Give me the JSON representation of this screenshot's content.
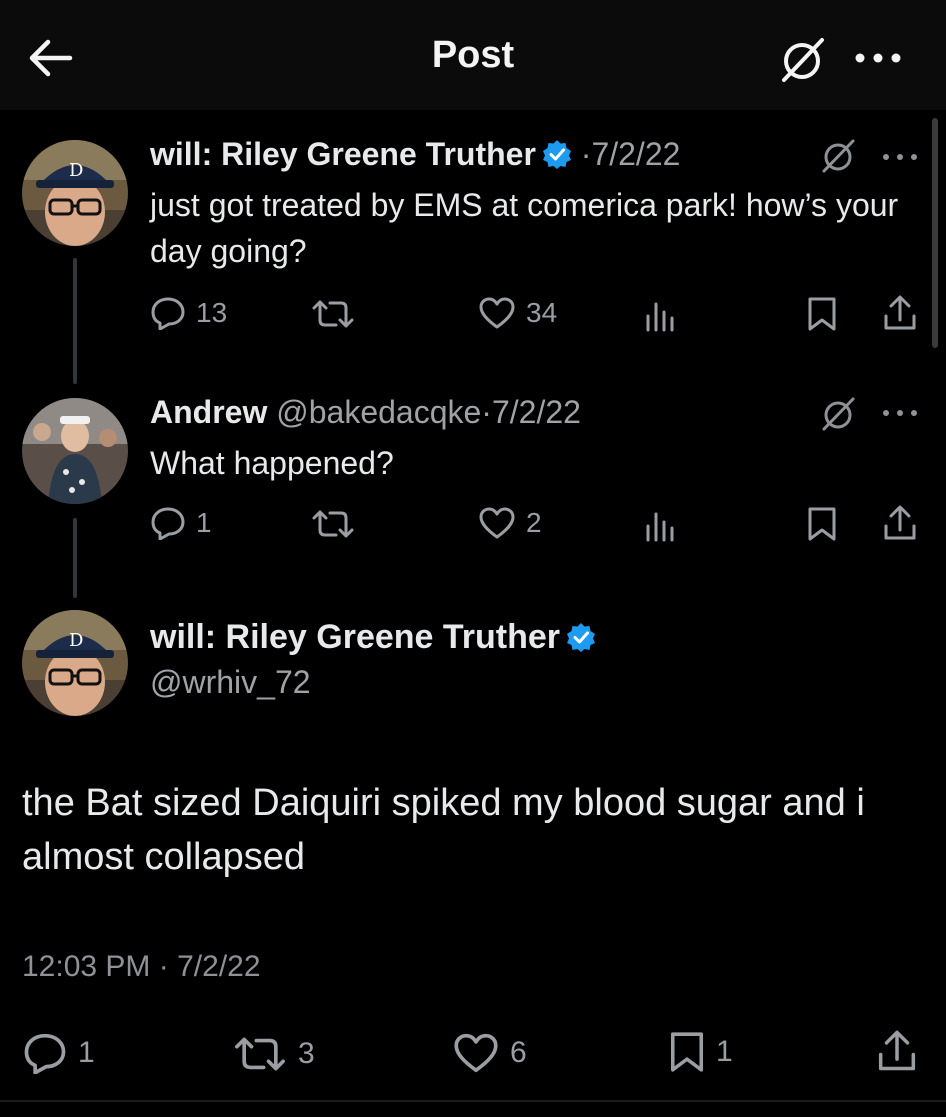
{
  "header": {
    "title": "Post",
    "back_icon": "arrow-left-icon",
    "grok_icon": "grok-icon",
    "more_icon": "more-horizontal-icon"
  },
  "colors": {
    "background": "#000000",
    "header_background": "#0b0b0b",
    "text": "#e7e9ea",
    "muted": "#a0a3a6",
    "verified": "#1d9bf0"
  },
  "tweets": [
    {
      "name": "will: Riley Greene Truther",
      "verified": true,
      "separator": "·",
      "date": "7/2/22",
      "text": "just got treated by EMS at comerica park! how’s your day going?",
      "replies": "13",
      "retweets": "",
      "likes": "34"
    },
    {
      "name": "Andrew",
      "handle": "@bakedacqke",
      "separator": "·",
      "date": "7/2/22",
      "text": "What happened?",
      "replies": "1",
      "retweets": "",
      "likes": "2"
    }
  ],
  "main_post": {
    "name": "will: Riley Greene Truther",
    "verified": true,
    "handle": "@wrhiv_72",
    "text": "the Bat sized Daiquiri spiked my blood sugar and i almost collapsed",
    "time": "12:03 PM",
    "separator": "·",
    "date": "7/2/22",
    "replies": "1",
    "retweets": "3",
    "likes": "6",
    "bookmarks": "1"
  }
}
